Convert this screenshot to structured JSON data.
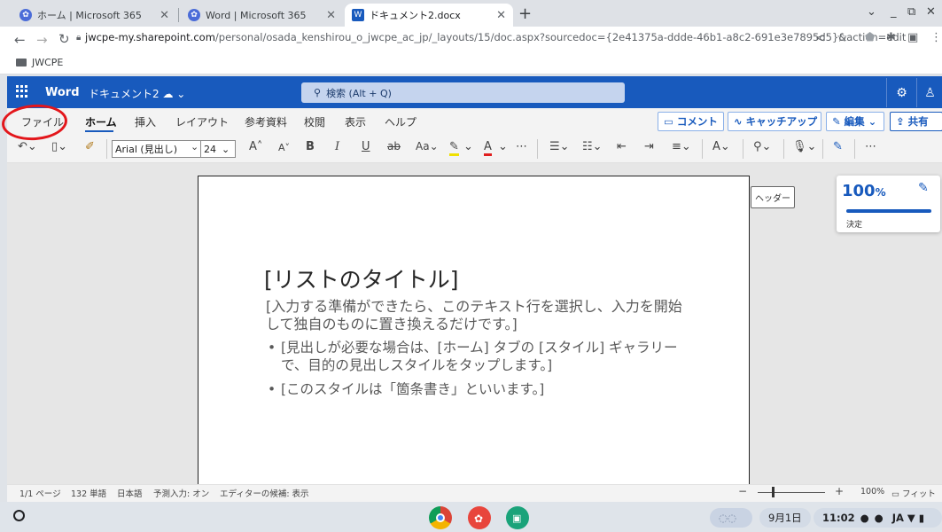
{
  "browser": {
    "tabs": [
      {
        "title": "ホーム | Microsoft 365"
      },
      {
        "title": "Word | Microsoft 365"
      },
      {
        "title": "ドキュメント2.docx"
      }
    ],
    "url_host": "jwcpe-my.sharepoint.com",
    "url_path": "/personal/osada_kenshirou_o_jwcpe_ac_jp/_layouts/15/doc.aspx?sourcedoc={2e41375a-ddde-46b1-a8c2-691e3e7895d5}&action=edit",
    "bookmark": "JWCPE"
  },
  "word": {
    "app_name": "Word",
    "doc_name": "ドキュメント2",
    "search_placeholder": "検索 (Alt + Q)",
    "ribbon_tabs": [
      "ファイル",
      "ホーム",
      "挿入",
      "レイアウト",
      "参考資料",
      "校閲",
      "表示",
      "ヘルプ"
    ],
    "comment_label": "コメント",
    "catchup_label": "キャッチアップ",
    "edit_label": "編集",
    "share_label": "共有",
    "font_name": "Arial (見出し)",
    "font_size": "24"
  },
  "document": {
    "title": "[リストのタイトル]",
    "paragraph": "[入力する準備ができたら、このテキスト行を選択し、入力を開始して独自のものに置き換えるだけです。]",
    "bullets": [
      "[見出しが必要な場合は、[ホーム] タブの [スタイル] ギャラリーで、目的の見出しスタイルをタップします。]",
      "[このスタイルは「箇条書き」といいます。]"
    ],
    "header_button": "ヘッダー"
  },
  "zoom_card": {
    "value": "100",
    "unit": "%",
    "confirm": "決定"
  },
  "status": {
    "page": "1/1 ページ",
    "words": "132 単語",
    "language": "日本語",
    "predictive": "予測入力: オン",
    "editor": "エディターの候補: 表示",
    "zoom": "100%",
    "fit": "フィット"
  },
  "shelf": {
    "date": "9月1日",
    "time": "11:02",
    "ime": "JA"
  }
}
